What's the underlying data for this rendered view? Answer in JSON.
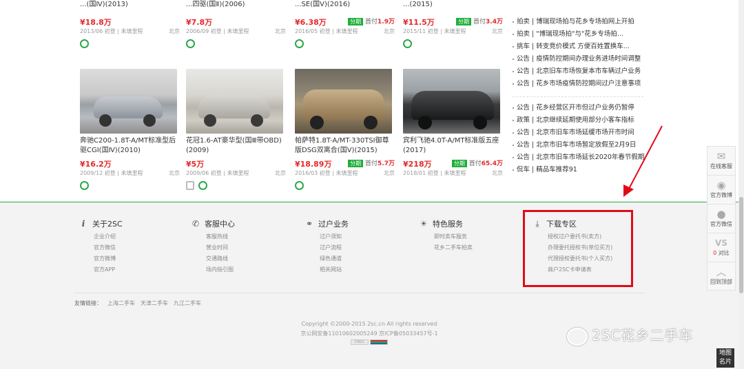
{
  "cars": [
    {
      "title": "...(国Ⅳ)(2013)",
      "price": "¥18.8万",
      "meta": "2013/06 初登 | 未填里程",
      "city": "北京",
      "installment": null
    },
    {
      "title": "...四驱(国Ⅱ)(2006)",
      "price": "¥7.8万",
      "meta": "2006/09 初登 | 未填里程",
      "city": "北京",
      "installment": null
    },
    {
      "title": "...SE(国Ⅴ)(2016)",
      "price": "¥6.38万",
      "meta": "2016/05 初登 | 未填里程",
      "city": "北京",
      "installment": {
        "tag": "分期",
        "dp_label": "首付",
        "amount": "1.9万"
      }
    },
    {
      "title": "...(2015)",
      "price": "¥11.5万",
      "meta": "2015/11 初登 | 未填里程",
      "city": "北京",
      "installment": {
        "tag": "分期",
        "dp_label": "首付",
        "amount": "3.4万"
      }
    },
    {
      "title": "奔驰C200-1.8T-A/MT标准型后驱CGI(国Ⅳ)(2010)",
      "price": "¥16.2万",
      "meta": "2009/12 初登 | 未填里程",
      "city": "北京",
      "installment": null
    },
    {
      "title": "花冠1.6-AT豪华型(国Ⅲ带OBD)(2009)",
      "price": "¥5万",
      "meta": "2009/06 初登 | 未填里程",
      "city": "北京",
      "installment": null
    },
    {
      "title": "帕萨特1.8T-A/MT-330TSI御尊版DSG双离合(国Ⅴ)(2015)",
      "price": "¥18.89万",
      "meta": "2016/03 初登 | 未填里程",
      "city": "北京",
      "installment": {
        "tag": "分期",
        "dp_label": "首付",
        "amount": "5.7万"
      }
    },
    {
      "title": "宾利飞驰4.0T-A/MT标准版五座(2017)",
      "price": "¥218万",
      "meta": "2018/01 初登 | 未填里程",
      "city": "北京",
      "installment": {
        "tag": "分期",
        "dp_label": "首付",
        "amount": "65.4万"
      }
    }
  ],
  "news_group1": [
    "拍卖 | 博瑞现场拍与花乡专场拍网上开拍",
    "拍卖 | \"博瑞现场拍\"与\"花乡专场拍...",
    "挑车 | 转变竞价模式 方便百姓置换车...",
    "公告 | 疫情防控期间办理业务进场时间调整",
    "公告 | 北京旧车市场恢复本市车辆过户业务",
    "公告 | 花乡市场疫情防控期间过户注意事项"
  ],
  "news_group2": [
    "公告 | 花乡经营区开市但过户业务仍暂停",
    "政策 | 北京继续延期使用部分小客车指标",
    "公告 | 北京市旧车市场延缓市场开市时间",
    "公告 | 北京市旧车市场暂定放假至2月9日",
    "公告 | 北京市旧车市场延长2020年春节假期",
    "侃车 | 精品车推荐91"
  ],
  "float_bar": {
    "service": "在线客服",
    "weibo": "官方微博",
    "wechat": "官方微信",
    "vs": "VS",
    "compare_count": "0",
    "compare_label": "对比",
    "top": "回到顶部"
  },
  "footer": {
    "about": {
      "title": "关于2SC",
      "items": [
        "企业介绍",
        "官方微信",
        "官方微博",
        "官方APP"
      ]
    },
    "service": {
      "title": "客服中心",
      "items": [
        "客服热线",
        "营业时间",
        "交通路线",
        "场内指引图"
      ]
    },
    "transfer": {
      "title": "过户业务",
      "items": [
        "过户须知",
        "过户流程",
        "绿色通道",
        "相关网站"
      ]
    },
    "special": {
      "title": "特色服务",
      "items": [
        "即时卖车服务",
        "花乡二手车拍卖"
      ]
    },
    "download": {
      "title": "下载专区",
      "items": [
        "授权过户委托书(卖方)",
        "办理委托授权书(单位买方)",
        "代理授权委托书(个人买方)",
        "商户2SC卡申请表"
      ]
    },
    "friend_label": "友情链接：",
    "friend_links": [
      "上海二手车",
      "天津二手车",
      "九江二手车"
    ],
    "copyright": "Copyright ©2000-2015 2sc.cn All rights reserved",
    "icp": "京公网安备11010602005249    京ICP备05033457号-1",
    "beian_badge": "CN22"
  },
  "watermark": "2SC花乡二手车",
  "map_button": "地图名片",
  "colors": {
    "price": "#e4282b",
    "installment": "#1fae3a",
    "border_green": "#2aa84a",
    "highlight": "#e20a17"
  }
}
